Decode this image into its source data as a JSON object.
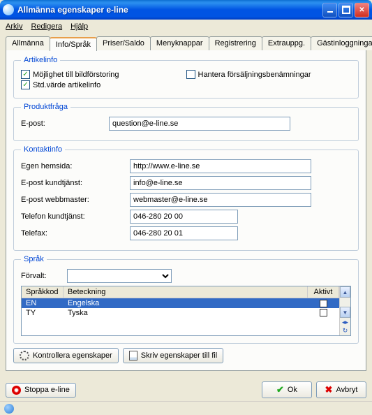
{
  "window": {
    "title": "Allmänna egenskaper e-line"
  },
  "menu": {
    "file": "Arkiv",
    "edit": "Redigera",
    "help": "Hjälp"
  },
  "tabs": {
    "items": [
      {
        "label": "Allmänna"
      },
      {
        "label": "Info/Språk"
      },
      {
        "label": "Priser/Saldo"
      },
      {
        "label": "Menyknappar"
      },
      {
        "label": "Registrering"
      },
      {
        "label": "Extrauppg."
      },
      {
        "label": "Gästinloggningar"
      }
    ],
    "active_index": 1
  },
  "artikelinfo": {
    "legend": "Artikelinfo",
    "cb_image": {
      "label": "Möjlighet till bildförstoring",
      "checked": true
    },
    "cb_default": {
      "label": "Std.värde artikelinfo",
      "checked": true
    },
    "cb_sales": {
      "label": "Hantera försäljningsbenämningar",
      "checked": false
    }
  },
  "produktfraga": {
    "legend": "Produktfråga",
    "email_label": "E-post:",
    "email_value": "question@e-line.se"
  },
  "kontaktinfo": {
    "legend": "Kontaktinfo",
    "hemsida_label": "Egen hemsida:",
    "hemsida_value": "http://www.e-line.se",
    "ekund_label": "E-post kundtjänst:",
    "ekund_value": "info@e-line.se",
    "eweb_label": "E-post webbmaster:",
    "eweb_value": "webmaster@e-line.se",
    "tel_label": "Telefon kundtjänst:",
    "tel_value": "046-280 20 00",
    "fax_label": "Telefax:",
    "fax_value": "046-280 20 01"
  },
  "sprak": {
    "legend": "Språk",
    "default_label": "Förvalt:",
    "default_value": "",
    "headers": {
      "code": "Språkkod",
      "name": "Beteckning",
      "active": "Aktivt"
    },
    "rows": [
      {
        "code": "EN",
        "name": "Engelska",
        "active": true,
        "selected": true
      },
      {
        "code": "TY",
        "name": "Tyska",
        "active": false,
        "selected": false
      }
    ]
  },
  "buttons": {
    "check": "Kontrollera egenskaper",
    "write": "Skriv egenskaper till fil",
    "stop": "Stoppa e-line",
    "ok": "Ok",
    "cancel": "Avbryt"
  }
}
